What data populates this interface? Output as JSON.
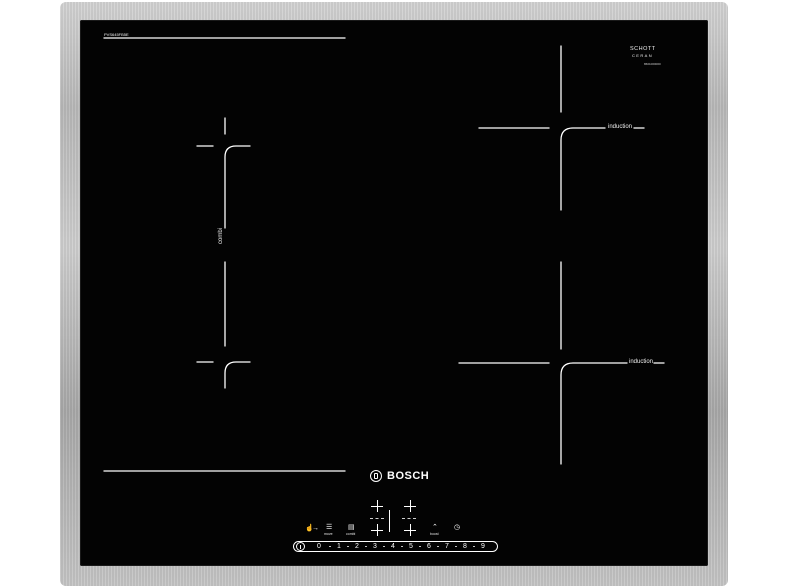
{
  "appliance": {
    "model_label": "PVS645FB5E",
    "glass_brand_line1": "SCHOTT",
    "glass_brand_line2": "CERAN",
    "glass_brand_line3": "8601000000",
    "zone_labels": {
      "top_right": "induction",
      "bottom_right": "induction",
      "left": "combi"
    },
    "logo_text": "BOSCH"
  },
  "controls": {
    "plus_buttons": [
      "plus-1",
      "plus-2",
      "plus-3",
      "plus-4"
    ],
    "function_labels": {
      "move": "move",
      "combi": "combi",
      "boost": "boost"
    },
    "slider_digits": [
      "0",
      "1",
      "2",
      "3",
      "4",
      "5",
      "6",
      "7",
      "8",
      "9"
    ],
    "slider_dots": [
      "·",
      "·",
      "·",
      "·",
      "·",
      "·",
      "·",
      "·",
      "·"
    ]
  },
  "colors": {
    "glass": "#030303",
    "frame": "#bdbdbd",
    "lines": "#ffffff"
  }
}
